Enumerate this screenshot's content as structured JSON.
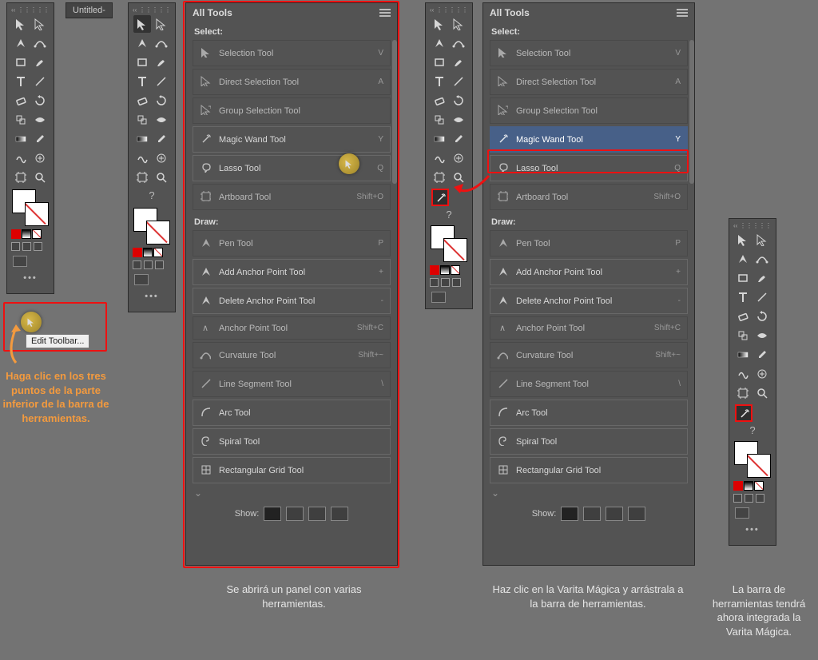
{
  "tab": {
    "untitled": "Untitled-"
  },
  "tooltip": {
    "edit_toolbar": "Edit Toolbar..."
  },
  "panel": {
    "title": "All Tools",
    "show_label": "Show:",
    "sections": {
      "select": {
        "label": "Select:",
        "items": [
          {
            "name": "Selection Tool",
            "shortcut": "V"
          },
          {
            "name": "Direct Selection Tool",
            "shortcut": "A"
          },
          {
            "name": "Group Selection Tool",
            "shortcut": ""
          },
          {
            "name": "Magic Wand Tool",
            "shortcut": "Y"
          },
          {
            "name": "Lasso Tool",
            "shortcut": "Q"
          },
          {
            "name": "Artboard Tool",
            "shortcut": "Shift+O"
          }
        ]
      },
      "draw": {
        "label": "Draw:",
        "items": [
          {
            "name": "Pen Tool",
            "shortcut": "P"
          },
          {
            "name": "Add Anchor Point Tool",
            "shortcut": "+"
          },
          {
            "name": "Delete Anchor Point Tool",
            "shortcut": "-"
          },
          {
            "name": "Anchor Point Tool",
            "shortcut": "Shift+C"
          },
          {
            "name": "Curvature Tool",
            "shortcut": "Shift+~"
          },
          {
            "name": "Line Segment Tool",
            "shortcut": "\\"
          },
          {
            "name": "Arc Tool",
            "shortcut": ""
          },
          {
            "name": "Spiral Tool",
            "shortcut": ""
          },
          {
            "name": "Rectangular Grid Tool",
            "shortcut": ""
          }
        ]
      }
    }
  },
  "captions": {
    "c1": "Haga clic en los tres puntos de la parte inferior de la barra de herramientas.",
    "c2": "Se abrirá un panel con varias herramientas.",
    "c3": "Haz clic en la Varita Mágica y arrástrala a la barra de herramientas.",
    "c4": "La barra de herramientas tendrá ahora integrada la Varita Mágica."
  },
  "more": "•••"
}
